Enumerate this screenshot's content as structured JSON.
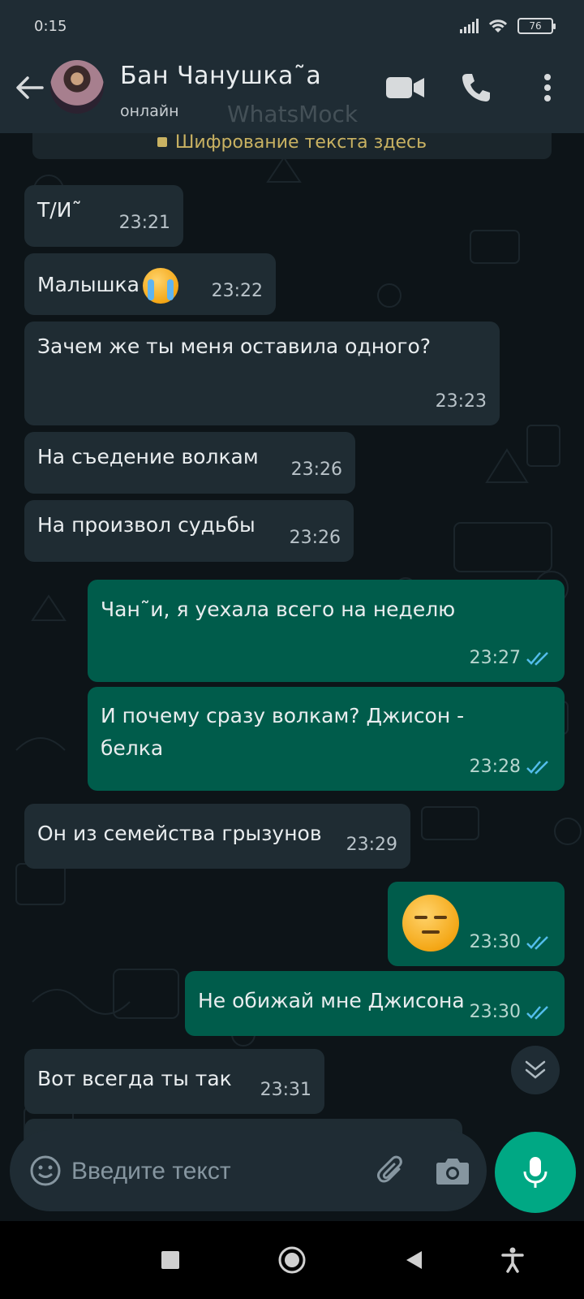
{
  "status_bar": {
    "time": "0:15",
    "battery": "76"
  },
  "header": {
    "contact_name": "Бан Чанушка˜а",
    "contact_status": "онлайн",
    "watermark": "WhatsMock"
  },
  "encryption_notice": "Шифрование текста здесь",
  "messages": [
    {
      "direction": "in",
      "text": "Т/И˜",
      "time": "23:21"
    },
    {
      "direction": "in",
      "text": "Малышка",
      "emoji": "loudly-crying-face",
      "time": "23:22"
    },
    {
      "direction": "in",
      "text": "Зачем же ты меня оставила одного?",
      "time": "23:23"
    },
    {
      "direction": "in",
      "text": "На съедение волкам",
      "time": "23:26"
    },
    {
      "direction": "in",
      "text": "На произвол судьбы",
      "time": "23:26"
    },
    {
      "direction": "out",
      "text": "Чан˜и, я уехала всего на неделю",
      "time": "23:27",
      "read": true
    },
    {
      "direction": "out",
      "text": "И почему сразу волкам? Джисон - белка",
      "time": "23:28",
      "read": true
    },
    {
      "direction": "in",
      "text": "Он из семейства грызунов",
      "time": "23:29"
    },
    {
      "direction": "out",
      "emoji": "expressionless-face",
      "time": "23:30",
      "read": true
    },
    {
      "direction": "out",
      "text": "Не обижай мне Джисона",
      "time": "23:30",
      "read": true
    },
    {
      "direction": "in",
      "text": "Вот всегда ты так",
      "time": "23:31"
    }
  ],
  "input": {
    "placeholder": "Введите текст"
  },
  "colors": {
    "incoming_bubble": "#1f2c33",
    "outgoing_bubble": "#005c4b",
    "accent": "#00a884",
    "read_ticks": "#53bdeb"
  }
}
